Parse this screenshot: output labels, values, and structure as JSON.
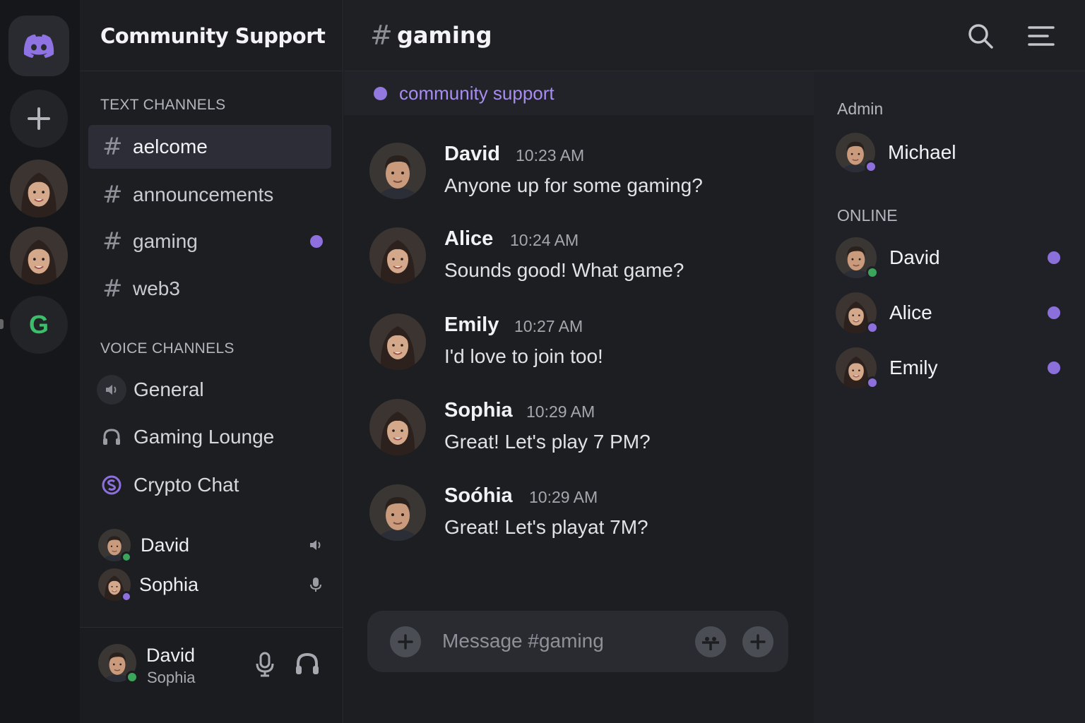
{
  "server": {
    "name": "Community Support",
    "rail_letter": "G"
  },
  "sidebar": {
    "text_header": "TEXT CHANNELS",
    "text_channels": [
      {
        "name": "aelcome",
        "active": true
      },
      {
        "name": "announcements"
      },
      {
        "name": "gaming",
        "unread": true
      },
      {
        "name": "web3"
      }
    ],
    "voice_header": "VOICE CHANNELS",
    "voice_channels": [
      {
        "name": "General",
        "icon": "speaker-icon"
      },
      {
        "name": "Gaming Lounge",
        "icon": "headphones-icon"
      },
      {
        "name": "Crypto Chat",
        "icon": "crypto-icon"
      }
    ],
    "voice_users": [
      {
        "name": "David",
        "status": "online",
        "icon": "speaker-icon"
      },
      {
        "name": "Sophia",
        "status": "idle",
        "icon": "microphone-icon"
      }
    ]
  },
  "user_panel": {
    "name": "David",
    "subtitle": "Sophia"
  },
  "channel": {
    "hash": "#",
    "name": "gaming",
    "topic": "community support"
  },
  "messages": [
    {
      "author": "David",
      "time": "10:23 AM",
      "text": "Anyone up for some gaming?"
    },
    {
      "author": "Alice",
      "time": "10:24 AM",
      "text": "Sounds good! What game?"
    },
    {
      "author": "Emily",
      "time": "10:27 AM",
      "text": "I'd love to join too!"
    },
    {
      "author": "Sophia",
      "time": "10:29 AM",
      "text": "Great! Let's play 7 PM?"
    },
    {
      "author": "Soóhia",
      "time": "10:29 AM",
      "text": "Great! Let's playat 7M?"
    }
  ],
  "composer": {
    "placeholder": "Message #gaming"
  },
  "members": {
    "admin_header": "Admin",
    "admins": [
      {
        "name": "Michael"
      }
    ],
    "online_header": "ONLINE",
    "online": [
      {
        "name": "David"
      },
      {
        "name": "Alice"
      },
      {
        "name": "Emily"
      }
    ]
  },
  "colors": {
    "accent": "#8d70dd",
    "online": "#3ba55c",
    "background": "#1d1e22"
  }
}
